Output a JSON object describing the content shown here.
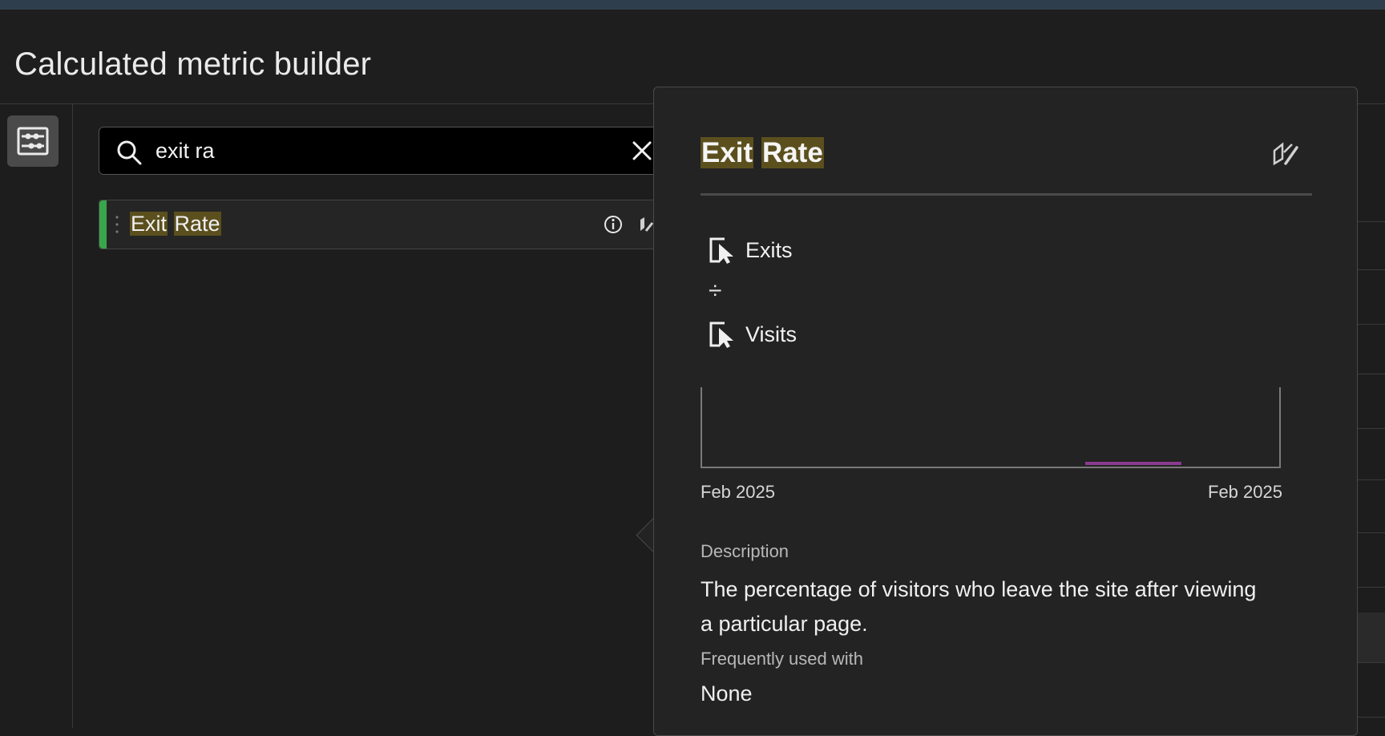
{
  "page": {
    "title": "Calculated metric builder"
  },
  "search": {
    "value": "exit ra",
    "placeholder": ""
  },
  "results": [
    {
      "label_parts": [
        "Exit",
        " ",
        "Rate"
      ]
    }
  ],
  "popover": {
    "title_parts": [
      "Exit",
      " ",
      "Rate"
    ],
    "formula": {
      "numerator": "Exits",
      "operator": "÷",
      "denominator": "Visits"
    },
    "trend": {
      "start_label": "Feb 2025",
      "end_label": "Feb 2025",
      "line_color": "#8a3b8f"
    },
    "description_label": "Description",
    "description": "The percentage of visitors who leave the site after viewing a particular page.",
    "frequently_used_label": "Frequently used with",
    "frequently_used_value": "None"
  },
  "colors": {
    "accent_green": "#3aa64b",
    "highlight": "#5b4f1e",
    "topbar": "#2f3e4c"
  },
  "icons": {
    "rail": "components-panel-icon",
    "search": "search-icon",
    "clear": "close-icon",
    "info": "info-icon",
    "edit": "edit-icon",
    "metric": "metric-icon"
  }
}
